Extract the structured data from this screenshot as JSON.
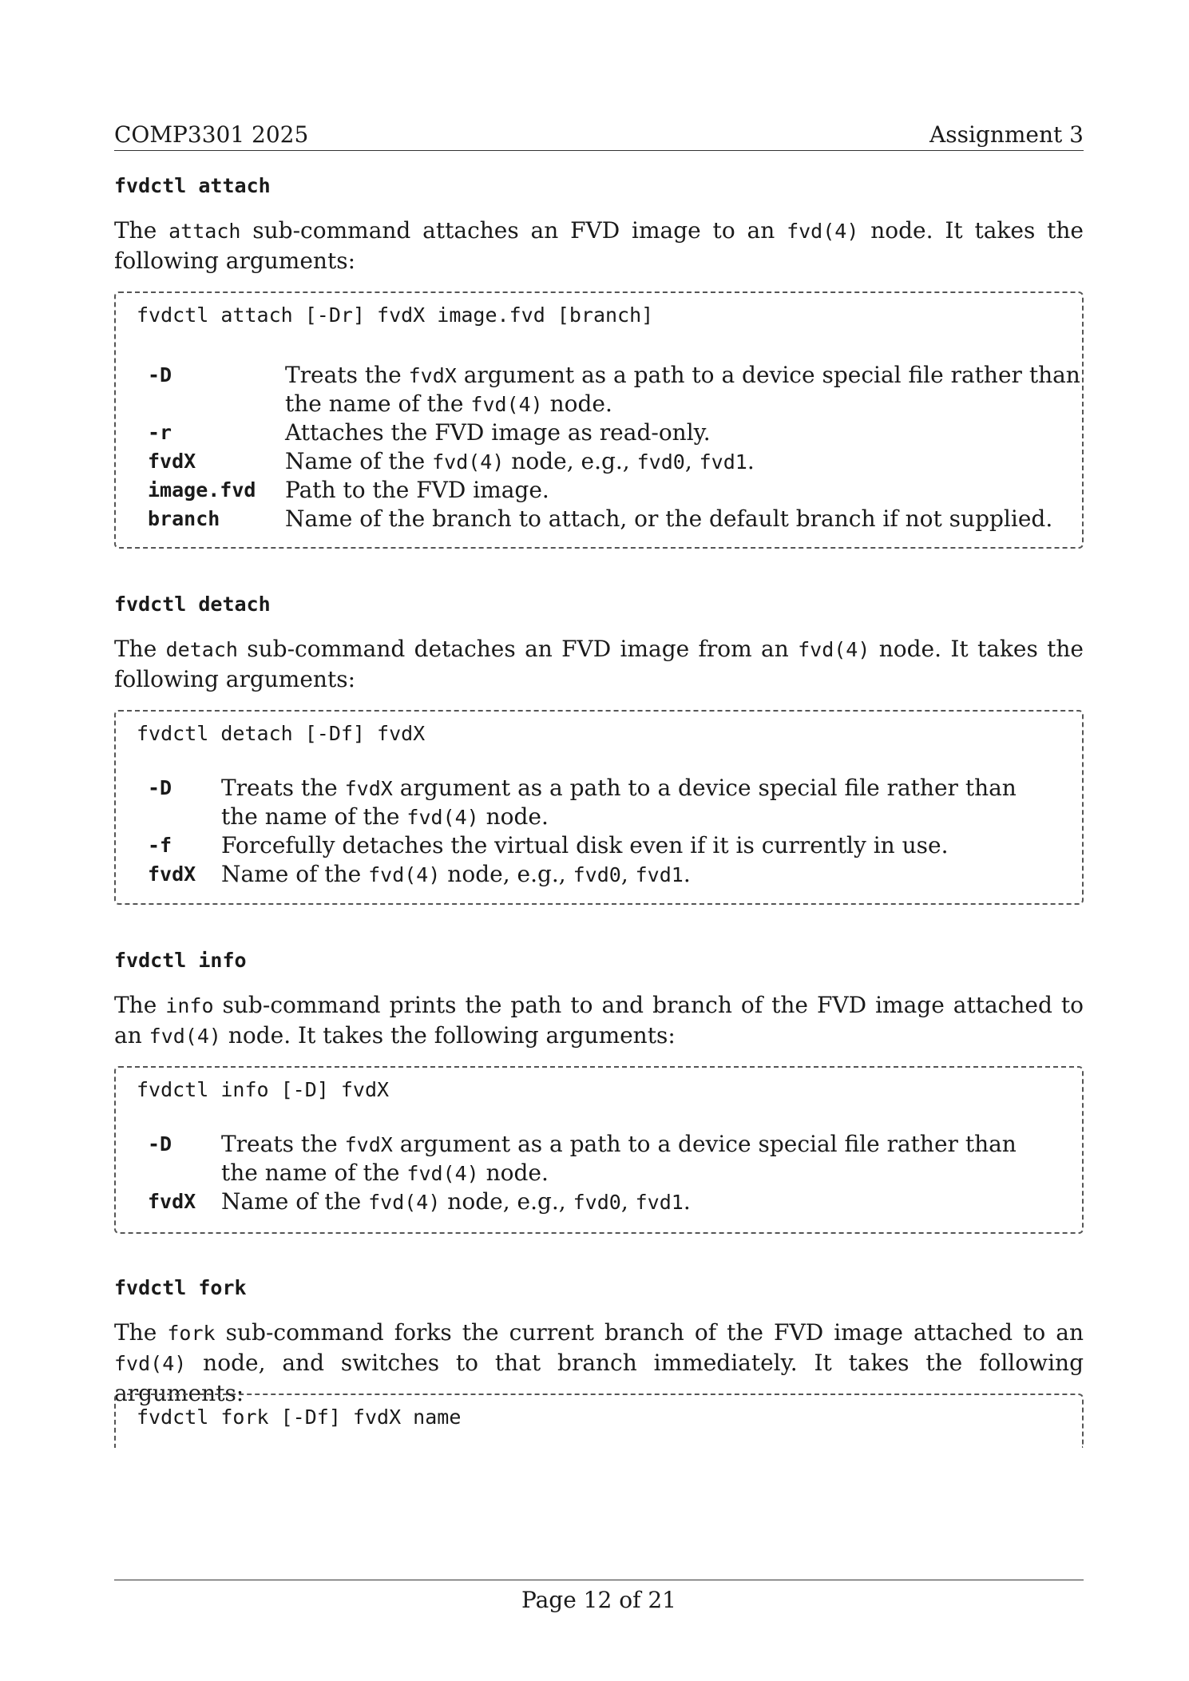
{
  "header": {
    "left": "COMP3301 2025",
    "right": "Assignment 3"
  },
  "sections": {
    "attach": {
      "title": "fvdctl attach",
      "intro": [
        "The ",
        "attach",
        " sub-command attaches an FVD image to an ",
        "fvd(4)",
        " node. It takes the following arguments:"
      ],
      "usage": "fvdctl attach [-Dr] fvdX image.fvd [branch]",
      "options": [
        {
          "name": "-D",
          "desc1": [
            "Treats the ",
            "fvdX",
            " argument as a path to a device special file rather than"
          ],
          "desc2": [
            "the name of the ",
            "fvd(4)",
            " node."
          ]
        },
        {
          "name": "-r",
          "desc1": [
            "Attaches the FVD image as read-only."
          ]
        },
        {
          "name": "fvdX",
          "desc1": [
            "Name of the ",
            "fvd(4)",
            " node, e.g., ",
            "fvd0",
            ", ",
            "fvd1",
            "."
          ]
        },
        {
          "name": "image.fvd",
          "desc1": [
            "Path to the FVD image."
          ]
        },
        {
          "name": "branch",
          "desc1": [
            "Name of the branch to attach, or the default branch if not supplied."
          ]
        }
      ]
    },
    "detach": {
      "title": "fvdctl detach",
      "intro": [
        "The ",
        "detach",
        " sub-command detaches an FVD image from an ",
        "fvd(4)",
        " node. It takes the following arguments:"
      ],
      "usage": "fvdctl detach [-Df] fvdX",
      "options": [
        {
          "name": "-D",
          "desc1": [
            "Treats the ",
            "fvdX",
            " argument as a path to a device special file rather than"
          ],
          "desc2": [
            "the name of the ",
            "fvd(4)",
            " node."
          ]
        },
        {
          "name": "-f",
          "desc1": [
            "Forcefully detaches the virtual disk even if it is currently in use."
          ]
        },
        {
          "name": "fvdX",
          "desc1": [
            "Name of the ",
            "fvd(4)",
            " node, e.g., ",
            "fvd0",
            ", ",
            "fvd1",
            "."
          ]
        }
      ]
    },
    "info": {
      "title": "fvdctl info",
      "intro": [
        "The ",
        "info",
        " sub-command prints the path to and branch of the FVD image attached to an ",
        "fvd(4)",
        " node. It takes the following arguments:"
      ],
      "usage": "fvdctl info [-D] fvdX",
      "options": [
        {
          "name": "-D",
          "desc1": [
            "Treats the ",
            "fvdX",
            " argument as a path to a device special file rather than"
          ],
          "desc2": [
            "the name of the ",
            "fvd(4)",
            " node."
          ]
        },
        {
          "name": "fvdX",
          "desc1": [
            "Name of the ",
            "fvd(4)",
            " node, e.g., ",
            "fvd0",
            ", ",
            "fvd1",
            "."
          ]
        }
      ]
    },
    "fork": {
      "title": "fvdctl fork",
      "intro": [
        "The ",
        "fork",
        " sub-command forks the current branch of the FVD image attached to an ",
        "fvd(4)",
        " node, and switches to that branch immediately. It takes the following arguments:"
      ],
      "usage": "fvdctl fork [-Df] fvdX name"
    }
  },
  "footer": {
    "page": "Page 12 of 21"
  }
}
